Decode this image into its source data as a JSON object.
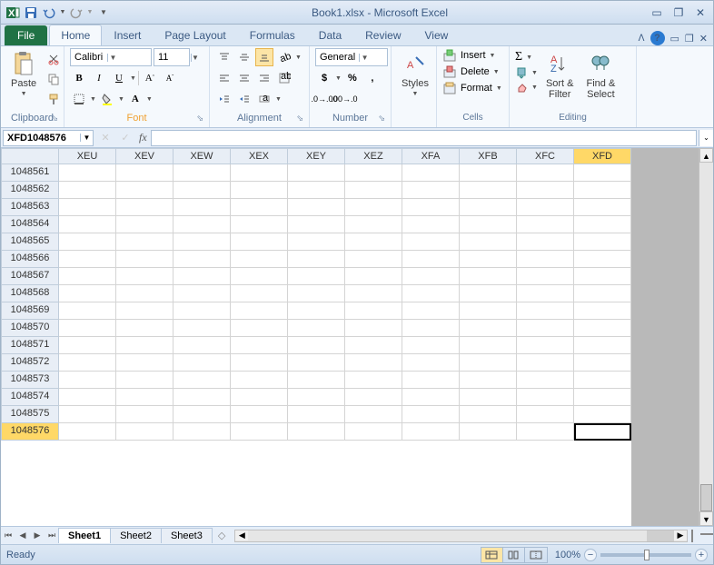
{
  "title": "Book1.xlsx - Microsoft Excel",
  "tabs": {
    "file": "File",
    "items": [
      "Home",
      "Insert",
      "Page Layout",
      "Formulas",
      "Data",
      "Review",
      "View"
    ],
    "active": 0
  },
  "ribbon": {
    "clipboard": {
      "paste": "Paste",
      "label": "Clipboard"
    },
    "font": {
      "name": "Calibri",
      "size": "11",
      "label": "Font"
    },
    "alignment": {
      "label": "Alignment"
    },
    "number": {
      "format": "General",
      "label": "Number"
    },
    "styles": {
      "styles": "Styles"
    },
    "cells": {
      "insert": "Insert",
      "delete": "Delete",
      "format": "Format",
      "label": "Cells"
    },
    "editing": {
      "sort": "Sort &\nFilter",
      "find": "Find &\nSelect",
      "label": "Editing"
    }
  },
  "namebox": "XFD1048576",
  "columns": [
    "XEU",
    "XEV",
    "XEW",
    "XEX",
    "XEY",
    "XEZ",
    "XFA",
    "XFB",
    "XFC",
    "XFD"
  ],
  "rows": [
    1048561,
    1048562,
    1048563,
    1048564,
    1048565,
    1048566,
    1048567,
    1048568,
    1048569,
    1048570,
    1048571,
    1048572,
    1048573,
    1048574,
    1048575,
    1048576
  ],
  "sheets": [
    "Sheet1",
    "Sheet2",
    "Sheet3"
  ],
  "status": "Ready",
  "zoom": "100%"
}
